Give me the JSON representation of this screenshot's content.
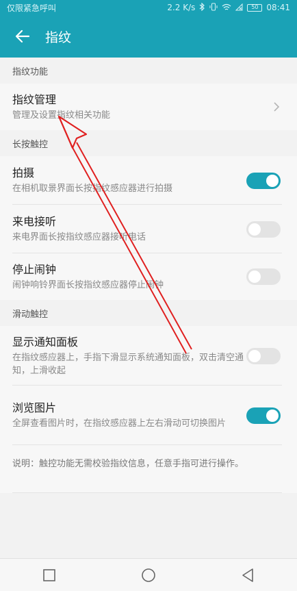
{
  "status_bar": {
    "carrier": "仅限紧急呼叫",
    "speed": "2.2 K/s",
    "battery": "50",
    "time": "08:41"
  },
  "app_bar": {
    "title": "指纹"
  },
  "sections": [
    {
      "header": "指纹功能",
      "items": [
        {
          "title": "指纹管理",
          "subtitle": "管理及设置指纹相关功能",
          "control": "chevron"
        }
      ]
    },
    {
      "header": "长按触控",
      "items": [
        {
          "title": "拍摄",
          "subtitle": "在相机取景界面长按指纹感应器进行拍摄",
          "control": "toggle",
          "on": true
        },
        {
          "title": "来电接听",
          "subtitle": "来电界面长按指纹感应器接听电话",
          "control": "toggle",
          "on": false
        },
        {
          "title": "停止闹钟",
          "subtitle": "闹钟响铃界面长按指纹感应器停止闹钟",
          "control": "toggle",
          "on": false
        }
      ]
    },
    {
      "header": "滑动触控",
      "items": [
        {
          "title": "显示通知面板",
          "subtitle": "在指纹感应器上，手指下滑显示系统通知面板，双击清空通知，上滑收起",
          "control": "toggle",
          "on": false
        },
        {
          "title": "浏览图片",
          "subtitle": "全屏查看图片时，在指纹感应器上左右滑动可切换图片",
          "control": "toggle",
          "on": true
        }
      ]
    }
  ],
  "note": "说明：触控功能无需校验指纹信息，任意手指可进行操作。",
  "colors": {
    "accent": "#1aa2b6",
    "annotation_arrow": "#e02020"
  },
  "icons": {
    "back": "arrow-left-icon",
    "chevron": "chevron-right-icon",
    "nav": [
      "square-icon",
      "circle-icon",
      "triangle-left-icon"
    ]
  }
}
